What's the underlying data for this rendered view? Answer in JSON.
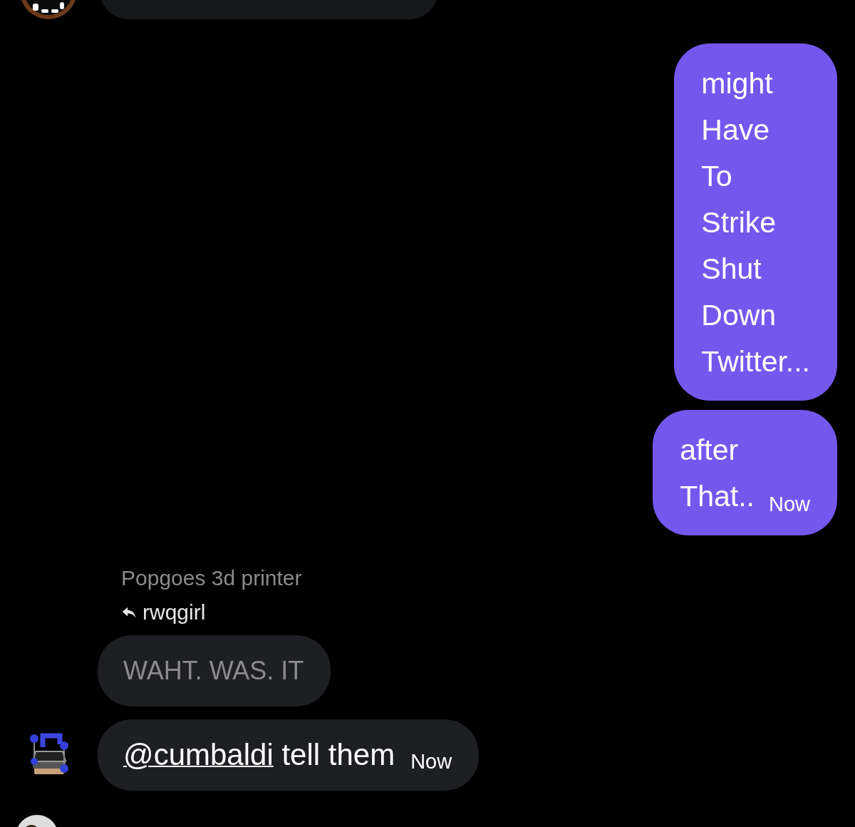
{
  "messages": [
    {
      "kind": "cut_off_top",
      "avatar": true
    },
    {
      "kind": "sent",
      "text": "might\nHave\nTo\nStrike\nShut\nDown\nTwitter..."
    },
    {
      "kind": "sent",
      "text": "after\nThat..",
      "time": "Now"
    },
    {
      "kind": "received",
      "author": "Popgoes 3d printer",
      "reply_to": "rwqgirl",
      "text": "WAHT. WAS. IT",
      "avatar": false
    },
    {
      "kind": "received",
      "mention": "@cumbaldi",
      "text": "tell them",
      "time": "Now",
      "avatar": true
    },
    {
      "kind": "cut_off_bottom",
      "avatar": true
    }
  ]
}
